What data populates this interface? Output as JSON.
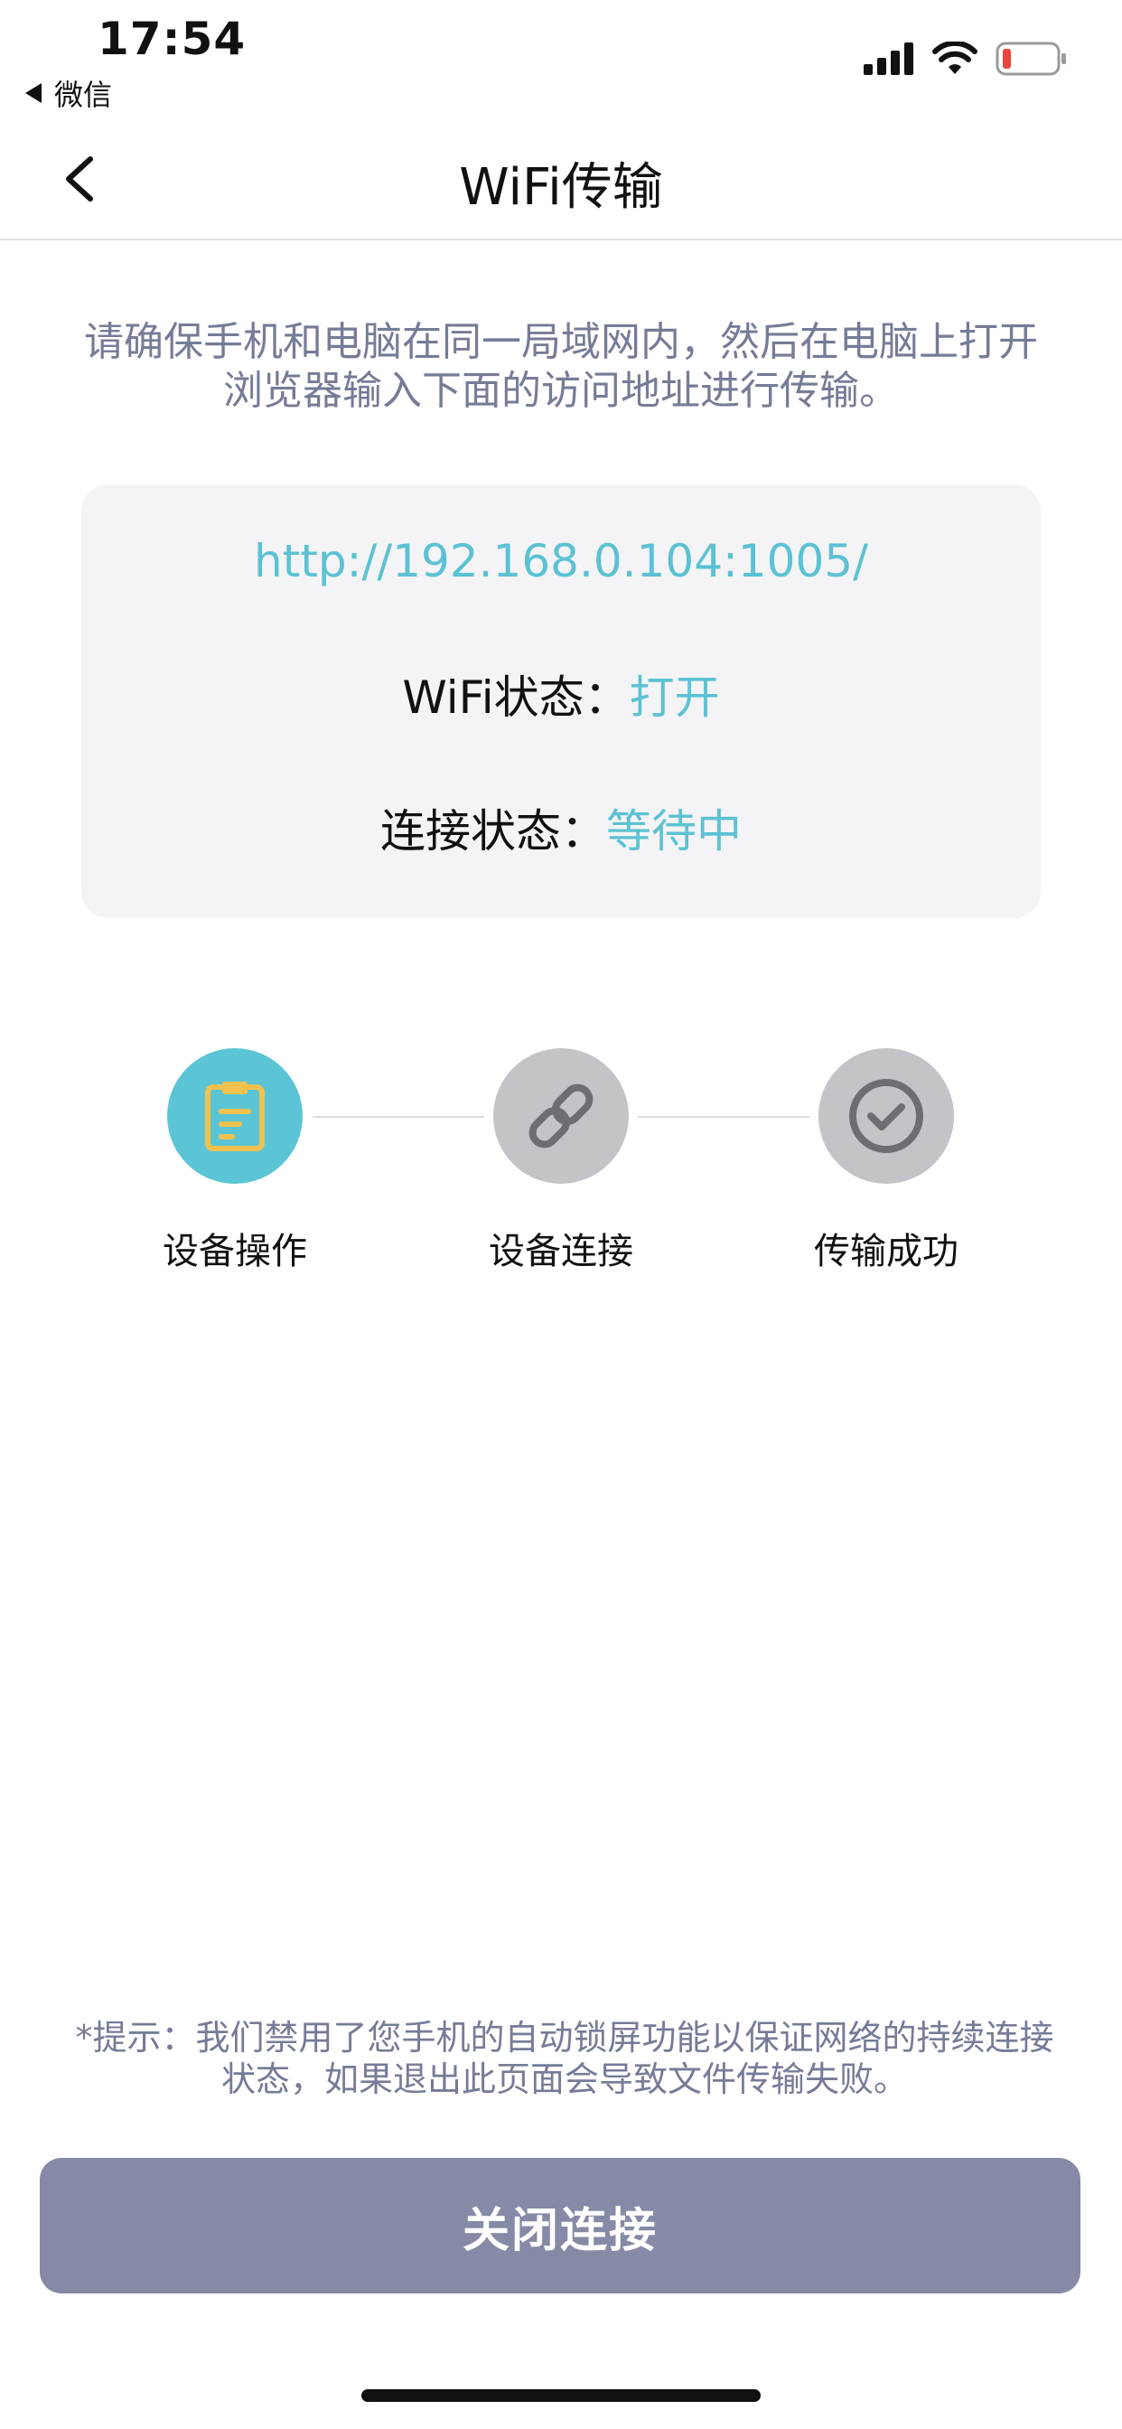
{
  "status_bar": {
    "time": "17:54",
    "back_app": "微信"
  },
  "nav": {
    "title": "WiFi传输"
  },
  "instruction": "请确保手机和电脑在同一局域网内，然后在电脑上打开浏览器输入下面的访问地址进行传输。",
  "info": {
    "url": "http://192.168.0.104:1005/",
    "wifi_label": "WiFi状态：",
    "wifi_value": "打开",
    "conn_label": "连接状态：",
    "conn_value": "等待中"
  },
  "steps": [
    {
      "label": "设备操作",
      "icon": "clipboard-icon",
      "active": true
    },
    {
      "label": "设备连接",
      "icon": "link-icon",
      "active": false
    },
    {
      "label": "传输成功",
      "icon": "check-circle-icon",
      "active": false
    }
  ],
  "hint": "*提示：我们禁用了您手机的自动锁屏功能以保证网络的持续连接状态，如果退出此页面会导致文件传输失败。",
  "close_button": "关闭连接",
  "colors": {
    "accent": "#5bc5d5",
    "muted_text": "#767b97",
    "button_bg": "#868aa6",
    "card_bg": "#f4f4f6",
    "icon_yellow": "#f2c14e",
    "battery_red": "#e8453c"
  }
}
